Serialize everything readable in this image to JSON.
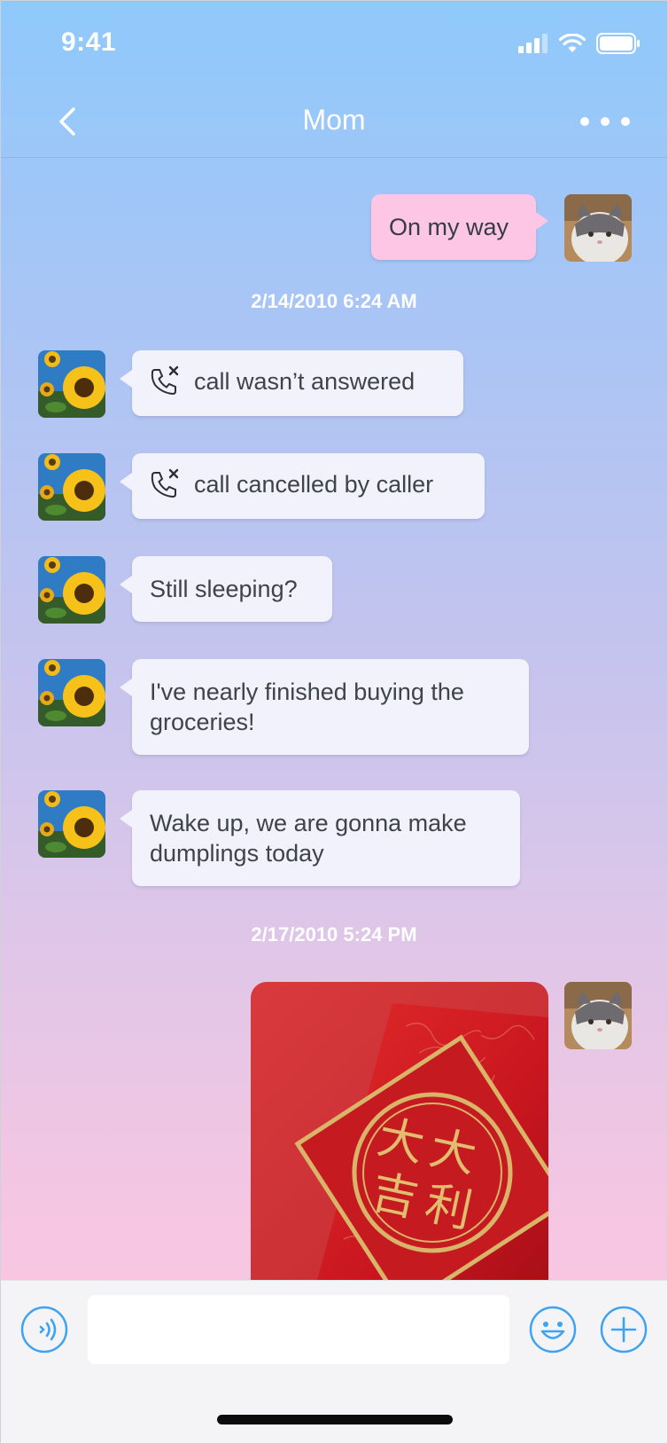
{
  "status_bar": {
    "time": "9:41"
  },
  "header": {
    "title": "Mom"
  },
  "messages": {
    "m1": {
      "text": "On my way"
    },
    "ts1": "2/14/2010 6:24 AM",
    "m2": {
      "text": "call wasn’t answered",
      "icon": "missed-call-icon"
    },
    "m3": {
      "text": "call cancelled by caller",
      "icon": "missed-call-icon"
    },
    "m4": {
      "text": "Still sleeping?"
    },
    "m5": {
      "line1": "I've nearly finished buying the",
      "line2": "groceries!"
    },
    "m6": {
      "line1": "Wake up, we are gonna make",
      "line2": "dumplings today"
    },
    "ts2": "2/17/2010 5:24 PM",
    "m7": {
      "type": "image",
      "subject": "red envelope",
      "characters": "大吉利"
    }
  },
  "input": {
    "value": "",
    "placeholder": ""
  },
  "colors": {
    "accent": "#3da3f2",
    "outgoing_bubble": "#fcc6e4",
    "incoming_bubble": "#f1f2fb"
  }
}
